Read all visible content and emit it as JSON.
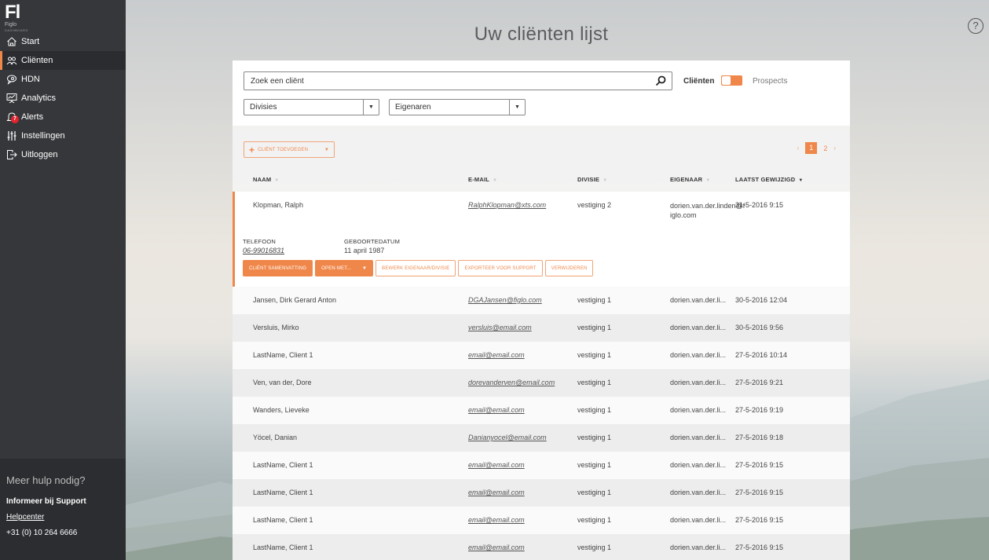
{
  "sidebar": {
    "logo": {
      "mark": "Fl",
      "name": "Figlo",
      "tagline": "DASHBOARD"
    },
    "items": [
      {
        "label": "Start",
        "icon": "home-icon",
        "active": false
      },
      {
        "label": "Cliënten",
        "icon": "users-icon",
        "active": true
      },
      {
        "label": "HDN",
        "icon": "chat-icon",
        "active": false
      },
      {
        "label": "Analytics",
        "icon": "presentation-chart-icon",
        "active": false
      },
      {
        "label": "Alerts",
        "icon": "bell-icon",
        "active": false,
        "badge": "7"
      },
      {
        "label": "Instellingen",
        "icon": "sliders-icon",
        "active": false
      },
      {
        "label": "Uitloggen",
        "icon": "logout-icon",
        "active": false
      }
    ],
    "help": {
      "title": "Meer hulp nodig?",
      "support": "Informeer bij Support",
      "helpcenter": "Helpcenter",
      "phone": "+31 (0) 10 264 6666"
    }
  },
  "header": {
    "title": "Uw cliënten lijst",
    "help_icon": "?"
  },
  "filters": {
    "search_placeholder": "Zoek een cliënt",
    "search_value": "",
    "toggle_left": "Cliënten",
    "toggle_right": "Prospects",
    "divisies": "Divisies",
    "eigenaren": "Eigenaren",
    "dropdown_arrow": "▼"
  },
  "toolbar": {
    "add_label": "CLIËNT TOEVOEGEN",
    "add_plus": "+",
    "caret": "▼",
    "pagination": {
      "prev": "‹",
      "next": "›",
      "pages": [
        "1",
        "2"
      ],
      "current": "1"
    }
  },
  "table": {
    "columns": [
      {
        "label": "NAAM",
        "sort": "▼",
        "sorted": false
      },
      {
        "label": "E-MAIL",
        "sort": "▼",
        "sorted": false
      },
      {
        "label": "DIVISIE",
        "sort": "▼",
        "sorted": false
      },
      {
        "label": "EIGENAAR",
        "sort": "▼",
        "sorted": false
      },
      {
        "label": "LAATST GEWIJZIGD",
        "sort": "▼",
        "sorted": true
      }
    ],
    "expanded": {
      "name": "Klopman, Ralph",
      "email": "RalphKlopman@xts.com",
      "division": "vestiging 2",
      "owner": "dorien.van.der.linden@figlo.com",
      "modified": "31-5-2016 9:15",
      "phone_label": "TELEFOON",
      "phone": "06-99016831",
      "birth_label": "GEBOORTEDATUM",
      "birth": "11 april 1987",
      "actions": {
        "summary": "CLIËNT SAMENVATTING",
        "open_with": "OPEN MET...",
        "open_caret": "▼",
        "edit_owner": "BEWERK EIGENAAR/DIVISIE",
        "export": "EXPORTEER VOOR SUPPORT",
        "delete": "VERWIJDEREN"
      }
    },
    "rows": [
      {
        "name": "Jansen, Dirk Gerard Anton",
        "email": "DGAJansen@figlo.com",
        "division": "vestiging 1",
        "owner": "dorien.van.der.li...",
        "modified": "30-5-2016 12:04"
      },
      {
        "name": "Versluis, Mirko",
        "email": "versluis@email.com",
        "division": "vestiging 1",
        "owner": "dorien.van.der.li...",
        "modified": "30-5-2016 9:56"
      },
      {
        "name": "LastName, Client 1",
        "email": "email@email.com",
        "division": "vestiging 1",
        "owner": "dorien.van.der.li...",
        "modified": "27-5-2016 10:14"
      },
      {
        "name": "Ven, van der, Dore",
        "email": "dorevanderven@email.com",
        "division": "vestiging 1",
        "owner": "dorien.van.der.li...",
        "modified": "27-5-2016 9:21"
      },
      {
        "name": "Wanders, Lieveke",
        "email": "email@email.com",
        "division": "vestiging 1",
        "owner": "dorien.van.der.li...",
        "modified": "27-5-2016 9:19"
      },
      {
        "name": "Yöcel, Danian",
        "email": "Danianyocel@email.com",
        "division": "vestiging 1",
        "owner": "dorien.van.der.li...",
        "modified": "27-5-2016 9:18"
      },
      {
        "name": "LastName, Client 1",
        "email": "email@email.com",
        "division": "vestiging 1",
        "owner": "dorien.van.der.li...",
        "modified": "27-5-2016 9:15"
      },
      {
        "name": "LastName, Client 1",
        "email": "email@email.com",
        "division": "vestiging 1",
        "owner": "dorien.van.der.li...",
        "modified": "27-5-2016 9:15"
      },
      {
        "name": "LastName, Client 1",
        "email": "email@email.com",
        "division": "vestiging 1",
        "owner": "dorien.van.der.li...",
        "modified": "27-5-2016 9:15"
      },
      {
        "name": "LastName, Client 1",
        "email": "email@email.com",
        "division": "vestiging 1",
        "owner": "dorien.van.der.li...",
        "modified": "27-5-2016 9:15"
      }
    ]
  },
  "colors": {
    "accent": "#f0874a",
    "sidebar_bg": "#35373a",
    "badge": "#e4232d"
  }
}
